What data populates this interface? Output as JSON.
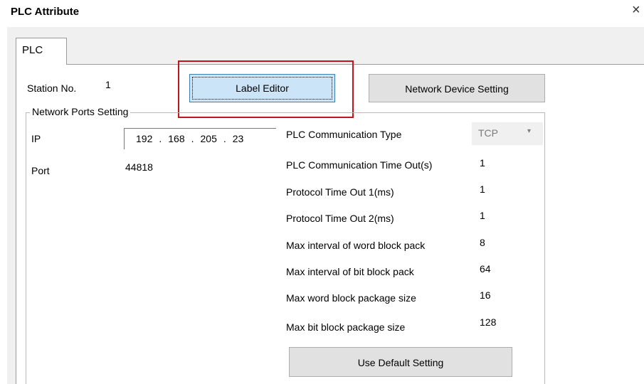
{
  "window": {
    "title": "PLC Attribute",
    "close": "×"
  },
  "tab": {
    "label": "PLC"
  },
  "station": {
    "label": "Station No.",
    "value": "1"
  },
  "buttons": {
    "label_editor": "Label Editor",
    "network_device_setting": "Network Device Setting",
    "use_default_setting": "Use Default Setting"
  },
  "network_ports": {
    "legend": "Network Ports Setting",
    "ip_label": "IP",
    "ip": [
      "192",
      "168",
      "205",
      "23"
    ],
    "port_label": "Port",
    "port": "44818"
  },
  "comm": {
    "type_label": "PLC Communication Type",
    "type_value": "TCP",
    "rows": [
      {
        "label": "PLC Communication Time Out(s)",
        "value": "1"
      },
      {
        "label": "Protocol Time Out 1(ms)",
        "value": "1"
      },
      {
        "label": "Protocol Time Out 2(ms)",
        "value": "1"
      },
      {
        "label": "Max interval of word block pack",
        "value": "8"
      },
      {
        "label": "Max interval of bit block pack",
        "value": "64"
      },
      {
        "label": "Max word block package size",
        "value": "16"
      },
      {
        "label": "Max bit block package size",
        "value": "128"
      }
    ]
  },
  "colors": {
    "highlight": "#c0141e",
    "selected_button": "#cce4f7"
  }
}
